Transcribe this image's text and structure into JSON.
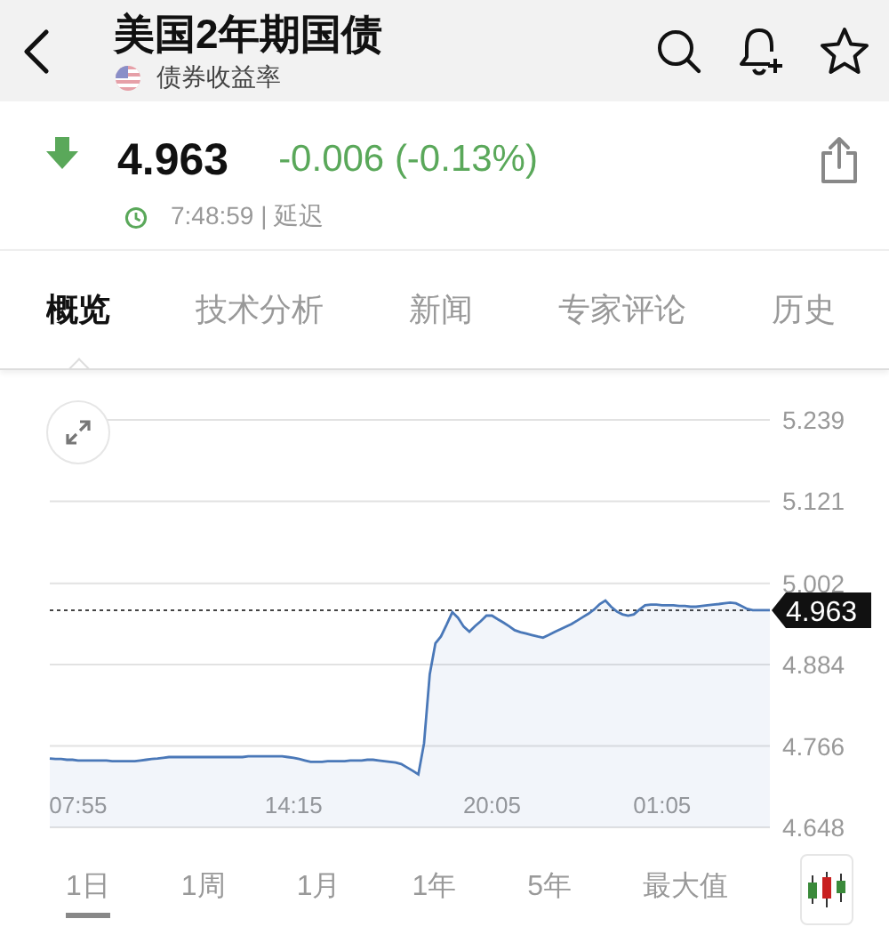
{
  "header": {
    "title": "美国2年期国债",
    "subtitle": "债券收益率"
  },
  "quote": {
    "price": "4.963",
    "change": "-0.006 (-0.13%)",
    "time": "7:48:59 | 延迟"
  },
  "tabs": [
    {
      "label": "概览",
      "selected": true
    },
    {
      "label": "技术分析",
      "selected": false
    },
    {
      "label": "新闻",
      "selected": false
    },
    {
      "label": "专家评论",
      "selected": false
    },
    {
      "label": "历史",
      "selected": false
    }
  ],
  "chart": {
    "chart_data": {
      "type": "area",
      "categories": [
        null,
        null,
        null,
        null,
        null,
        "07:55",
        null,
        null,
        null,
        null,
        null,
        null,
        null,
        null,
        null,
        null,
        null,
        null,
        null,
        null,
        null,
        null,
        null,
        null,
        null,
        null,
        null,
        null,
        null,
        null,
        null,
        null,
        null,
        null,
        null,
        null,
        null,
        null,
        null,
        null,
        null,
        null,
        null,
        "14:15",
        null,
        null,
        null,
        null,
        null,
        null,
        null,
        null,
        null,
        null,
        null,
        null,
        null,
        null,
        null,
        null,
        null,
        null,
        null,
        null,
        null,
        null,
        null,
        null,
        null,
        null,
        null,
        null,
        null,
        null,
        null,
        null,
        null,
        null,
        "20:05",
        null,
        null,
        null,
        null,
        null,
        null,
        null,
        null,
        null,
        null,
        null,
        null,
        null,
        null,
        null,
        null,
        null,
        null,
        null,
        null,
        null,
        null,
        null,
        null,
        null,
        null,
        null,
        null,
        null,
        "01:05",
        null,
        null,
        null,
        null,
        null,
        null,
        null,
        null,
        null,
        null,
        null,
        null,
        null,
        null,
        null,
        null,
        null,
        null,
        null
      ],
      "series": [
        {
          "color": "#4a78b8",
          "values": [
            4.748,
            4.747,
            4.747,
            4.746,
            4.746,
            4.745,
            4.745,
            4.745,
            4.745,
            4.745,
            4.745,
            4.744,
            4.744,
            4.744,
            4.744,
            4.744,
            4.745,
            4.746,
            4.747,
            4.748,
            4.749,
            4.75,
            4.75,
            4.75,
            4.75,
            4.75,
            4.75,
            4.75,
            4.75,
            4.75,
            4.75,
            4.75,
            4.75,
            4.75,
            4.75,
            4.751,
            4.751,
            4.751,
            4.751,
            4.751,
            4.751,
            4.751,
            4.75,
            4.749,
            4.747,
            4.745,
            4.743,
            4.743,
            4.743,
            4.744,
            4.744,
            4.744,
            4.744,
            4.745,
            4.745,
            4.745,
            4.746,
            4.746,
            4.745,
            4.744,
            4.743,
            4.742,
            4.74,
            4.735,
            4.73,
            4.725,
            4.77,
            4.87,
            4.915,
            4.925,
            4.942,
            4.96,
            4.952,
            4.939,
            4.932,
            4.94,
            4.947,
            4.955,
            4.955,
            4.95,
            4.945,
            4.94,
            4.934,
            4.931,
            4.929,
            4.927,
            4.925,
            4.923,
            4.927,
            4.931,
            4.935,
            4.939,
            4.943,
            4.948,
            4.953,
            4.958,
            4.964,
            4.972,
            4.977,
            4.968,
            4.961,
            4.957,
            4.955,
            4.957,
            4.964,
            4.97,
            4.971,
            4.971,
            4.97,
            4.97,
            4.97,
            4.969,
            4.969,
            4.968,
            4.968,
            4.969,
            4.97,
            4.971,
            4.972,
            4.973,
            4.974,
            4.973,
            4.969,
            4.965,
            4.963,
            4.963,
            4.963,
            4.963
          ]
        }
      ],
      "ylim": [
        4.648,
        5.239
      ],
      "yticks": [
        {
          "value": 5.239,
          "label": "5.239"
        },
        {
          "value": 5.121,
          "label": "5.121"
        },
        {
          "value": 5.002,
          "label": "5.002"
        },
        {
          "value": 4.884,
          "label": "4.884"
        },
        {
          "value": 4.766,
          "label": "4.766"
        },
        {
          "value": 4.648,
          "label": "4.648"
        }
      ],
      "grid": true,
      "ref_lines": [
        {
          "axis": "y",
          "value": 4.963,
          "label": "4.963"
        }
      ]
    }
  },
  "ranges": [
    {
      "label": "1日",
      "selected": true
    },
    {
      "label": "1周",
      "selected": false
    },
    {
      "label": "1月",
      "selected": false
    },
    {
      "label": "1年",
      "selected": false
    },
    {
      "label": "5年",
      "selected": false
    },
    {
      "label": "最大值",
      "selected": false
    }
  ]
}
